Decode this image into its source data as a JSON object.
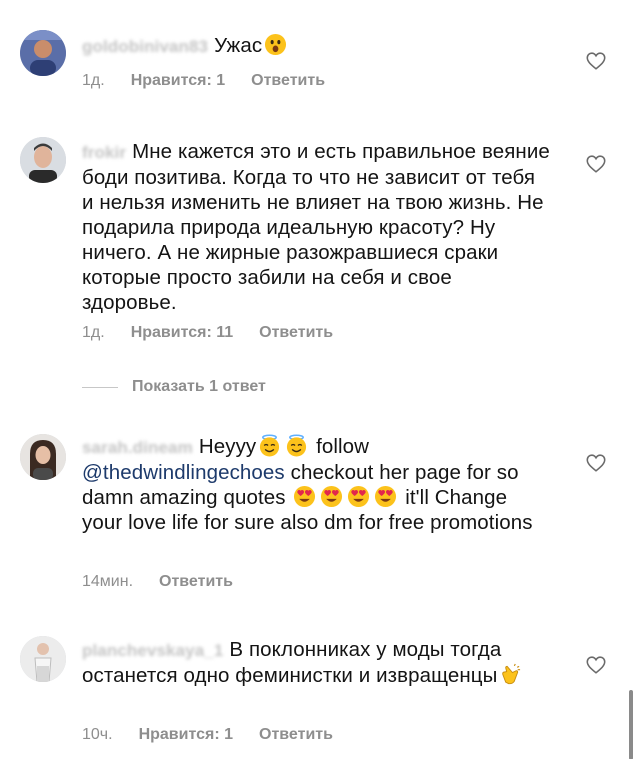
{
  "comments": [
    {
      "username": "goldobinivan83",
      "text_before": "Ужас",
      "emoji": "astonished-face",
      "time": "1д.",
      "likes": "Нравится: 1",
      "reply": "Ответить"
    },
    {
      "username": "frokir",
      "text": "Мне кажется это и есть правильное веяние боди позитива. Когда то что не зависит от тебя и нельзя изменить не влияет на твою жизнь. Не подарила природа идеальную красоту? Ну ничего. А не жирные разожравшиеся сраки которые просто забили на себя и свое здоровье.",
      "time": "1д.",
      "likes": "Нравится: 11",
      "reply": "Ответить"
    },
    {
      "username": "sarah.dineam",
      "text_start": "Heyyy",
      "text_follow": "follow",
      "mention": "@thedwindlingechoes",
      "text_mid": "checkout her page for so damn amazing quotes",
      "text_end": "it'll Change your love life for sure also dm for free promotions",
      "time": "14мин.",
      "reply": "Ответить"
    },
    {
      "username": "planchevskaya_1",
      "text": "В поклонниках у моды тогда останется одно феминистки и извращенцы",
      "emoji": "clapping-hands",
      "time": "10ч.",
      "likes": "Нравится: 1",
      "reply": "Ответить"
    }
  ],
  "show_replies": "Показать 1 ответ",
  "colors": {
    "meta": "#8e8e8e",
    "mention": "#1d3a6b",
    "emoji": "#fcc21b"
  }
}
